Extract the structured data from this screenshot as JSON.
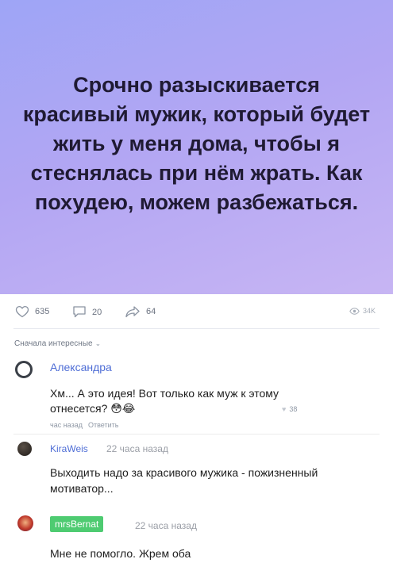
{
  "banner": {
    "text": "Срочно разыскивается красивый мужик, который будет жить у меня дома, чтобы я стеснялась при нём жрать. Как похудею, можем разбежаться.",
    "gradient": [
      "#9ea5f6",
      "#c7b5f3"
    ]
  },
  "actions": {
    "likes": "635",
    "comments": "20",
    "shares": "64",
    "views": "34K"
  },
  "sort": {
    "label": "Сначала интересные"
  },
  "comments": [
    {
      "name": "Александра",
      "text": "Хм... А это идея! Вот только как муж к этому отнесется? 😳😂",
      "likes": "38",
      "time": "час назад",
      "reply": "Ответить"
    },
    {
      "name": "KiraWeis",
      "time": "22 часа назад",
      "text": "Выходить надо за красивого мужика - пожизненный мотиватор..."
    },
    {
      "name": "mrsBernat",
      "time": "22 часа назад",
      "text": "Мне не помогло. Жрем оба"
    }
  ],
  "colors": {
    "accent_blue": "#4f6ed6",
    "badge_green": "#4ecb71"
  }
}
